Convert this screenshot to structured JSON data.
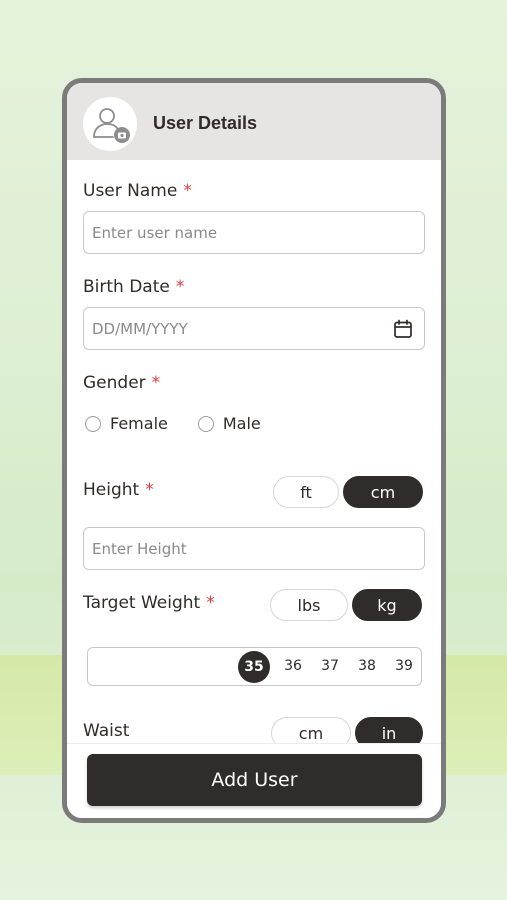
{
  "header": {
    "title": "User Details",
    "avatar_icon": "user-add-photo-icon"
  },
  "form": {
    "user_name": {
      "label": "User Name",
      "required_mark": "*",
      "placeholder": "Enter user name"
    },
    "birth_date": {
      "label": "Birth Date",
      "required_mark": "*",
      "placeholder": "DD/MM/YYYY",
      "icon": "calendar-icon"
    },
    "gender": {
      "label": "Gender",
      "required_mark": "*",
      "options": [
        "Female",
        "Male"
      ]
    },
    "height": {
      "label": "Height",
      "required_mark": "*",
      "units": [
        "ft",
        "cm"
      ],
      "selected_unit": "cm",
      "placeholder": "Enter Height"
    },
    "target_weight": {
      "label": "Target Weight",
      "required_mark": "*",
      "units": [
        "lbs",
        "kg"
      ],
      "selected_unit": "kg",
      "ruler_values": [
        "35",
        "36",
        "37",
        "38",
        "39"
      ],
      "selected_value": "35"
    },
    "waist": {
      "label": "Waist",
      "units": [
        "cm",
        "in"
      ],
      "selected_unit": "in"
    }
  },
  "footer": {
    "add_button_label": "Add User"
  },
  "colors": {
    "accent": "#302c2b",
    "required": "#e23b3b",
    "header_bg": "#e6e5e3",
    "frame": "#7b7b7b"
  }
}
